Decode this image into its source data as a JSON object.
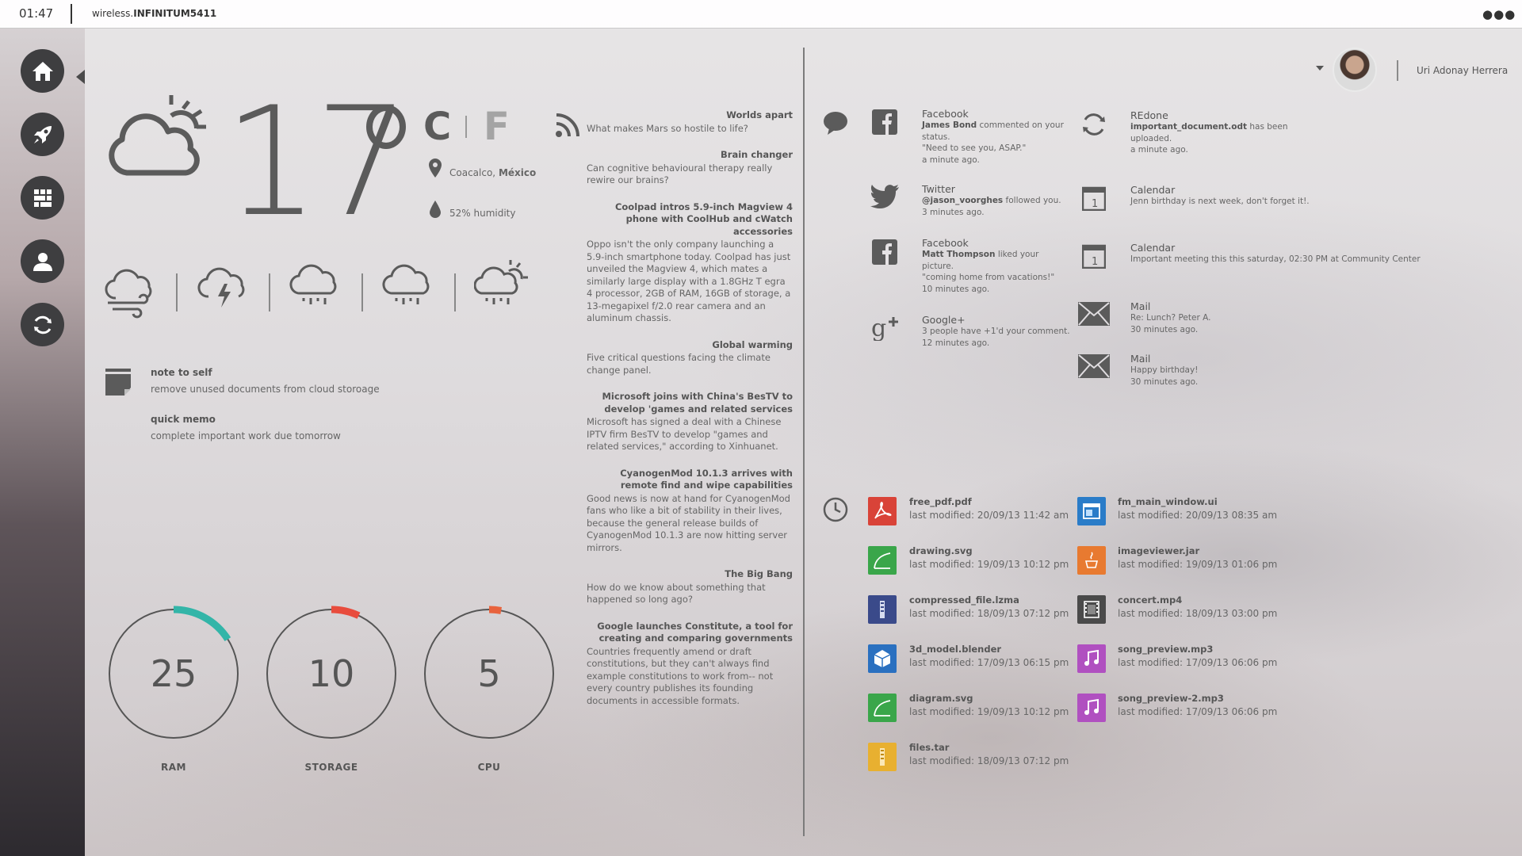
{
  "topbar": {
    "time": "01:47",
    "network_prefix": "wireless.",
    "network_name": "INFINITUM5411",
    "menu_icon": "more-dots-icon"
  },
  "sidebar": {
    "items": [
      {
        "icon": "home-icon"
      },
      {
        "icon": "rocket-icon"
      },
      {
        "icon": "apps-grid-icon"
      },
      {
        "icon": "user-icon"
      },
      {
        "icon": "refresh-icon"
      }
    ]
  },
  "weather": {
    "temperature": "17",
    "unit_c": "C",
    "unit_f": "F",
    "location_city": "Coacalco, ",
    "location_country": "México",
    "humidity": "52% humidity",
    "forecast_icons": [
      "windy-cloud-icon",
      "thunder-cloud-icon",
      "rain-cloud-icon",
      "rain-cloud-icon",
      "sun-rain-cloud-icon"
    ]
  },
  "notes": [
    {
      "title": "note to self",
      "text": "remove unused documents from cloud storoage"
    },
    {
      "title": "quick memo",
      "text": "complete important work due tomorrow"
    }
  ],
  "gauges": [
    {
      "label": "RAM",
      "value": "25",
      "fraction": 0.16,
      "color": "#33b5a8"
    },
    {
      "label": "STORAGE",
      "value": "10",
      "fraction": 0.07,
      "color": "#e84c3d"
    },
    {
      "label": "CPU",
      "value": "5",
      "fraction": 0.03,
      "color": "#e8633d"
    }
  ],
  "news": [
    {
      "title": "Worlds apart",
      "desc": "What makes Mars so hostile to life?"
    },
    {
      "title": "Brain changer",
      "desc": "Can cognitive behavioural therapy really rewire our brains?"
    },
    {
      "title": "Coolpad intros 5.9-inch Magview 4 phone with CoolHub and cWatch accessories",
      "desc": "Oppo isn't the only company launching a 5.9-inch smartphone today. Coolpad has just unveiled the Magview 4, which mates a similarly large display with a 1.8GHz T egra 4 processor, 2GB of RAM, 16GB of storage, a 13-megapixel f/2.0 rear camera and an aluminum chassis."
    },
    {
      "title": "Global warming",
      "desc": "Five critical questions facing the climate change panel."
    },
    {
      "title": "Microsoft joins with China's BesTV to develop 'games and related services",
      "desc": "Microsoft has signed a deal with a Chinese IPTV firm BesTV to develop \"games and related services,\" according to Xinhuanet."
    },
    {
      "title": "CyanogenMod 10.1.3 arrives with remote find and wipe capabilities",
      "desc": "Good news is now at hand for CyanogenMod fans who like a bit of stability in their lives, because the general release builds of CyanogenMod 10.1.3 are now hitting server mirrors."
    },
    {
      "title": "The Big Bang",
      "desc": "How do we know about something that happened so long ago?"
    },
    {
      "title": "Google launches Constitute, a tool for creating and comparing governments",
      "desc": "Countries frequently amend or draft constitutions, but they can't always find example constitutions to work from-- not every country publishes its founding documents in accessible formats."
    }
  ],
  "user": {
    "name": "Uri Adonay Herrera"
  },
  "notifications_left": [
    {
      "app": "Facebook",
      "icon": "facebook-icon",
      "actor": "James Bond",
      "text": " commented on your status.",
      "extra": "\"Need to see you, ASAP.\"",
      "time": "a minute ago."
    },
    {
      "app": "Twitter",
      "icon": "twitter-icon",
      "actor": "@jason_voorghes",
      "text": " followed you.",
      "extra": "",
      "time": "3 minutes ago."
    },
    {
      "app": "Facebook",
      "icon": "facebook-icon",
      "actor": "Matt Thompson",
      "text": " liked your picture.",
      "extra": "\"coming home from vacations!\"",
      "time": "10 minutes ago."
    },
    {
      "app": "Google+",
      "icon": "google-plus-icon",
      "actor": "",
      "text": "3 people have +1'd your comment.",
      "extra": "",
      "time": "12 minutes ago."
    }
  ],
  "notifications_right": [
    {
      "app": "REdone",
      "icon": "sync-icon",
      "actor": "important_document.odt",
      "text": " has been uploaded.",
      "time": "a minute ago."
    },
    {
      "app": "Calendar",
      "icon": "calendar-icon",
      "actor": "",
      "text": "Jenn birthday is next week, don't forget it!.",
      "time": ""
    },
    {
      "app": "Calendar",
      "icon": "calendar-icon",
      "actor": "",
      "text": "Important meeting this this saturday, 02:30 PM at Community Center",
      "time": ""
    },
    {
      "app": "Mail",
      "icon": "mail-icon",
      "actor": "",
      "text": "Re: Lunch? Peter A.",
      "time": "30 minutes ago."
    },
    {
      "app": "Mail",
      "icon": "mail-icon",
      "actor": "",
      "text": "Happy birthday!",
      "time": "30 minutes ago."
    }
  ],
  "files_left": [
    {
      "name": "free_pdf.pdf",
      "modified": "last modified: 20/09/13 11:42 am",
      "icon": "pdf-file-icon",
      "color": "#d94338"
    },
    {
      "name": "drawing.svg",
      "modified": "last modified: 19/09/13 10:12 pm",
      "icon": "svg-file-icon",
      "color": "#3aa64a"
    },
    {
      "name": "compressed_file.lzma",
      "modified": "last modified: 18/09/13 07:12 pm",
      "icon": "archive-file-icon",
      "color": "#3a4a8a"
    },
    {
      "name": "3d_model.blender",
      "modified": "last modified: 17/09/13 06:15 pm",
      "icon": "blender-file-icon",
      "color": "#2a70c0"
    },
    {
      "name": "diagram.svg",
      "modified": "last modified: 19/09/13 10:12 pm",
      "icon": "svg-file-icon",
      "color": "#3aa64a"
    },
    {
      "name": "files.tar",
      "modified": "last modified: 18/09/13 07:12 pm",
      "icon": "tar-file-icon",
      "color": "#e8b030"
    }
  ],
  "files_right": [
    {
      "name": "fm_main_window.ui",
      "modified": "last modified: 20/09/13 08:35 am",
      "icon": "ui-file-icon",
      "color": "#2a7cc8"
    },
    {
      "name": "imageviewer.jar",
      "modified": "last modified: 19/09/13 01:06 pm",
      "icon": "java-file-icon",
      "color": "#e87a30"
    },
    {
      "name": "concert.mp4",
      "modified": "last modified: 18/09/13 03:00 pm",
      "icon": "video-file-icon",
      "color": "#4a4a4a"
    },
    {
      "name": "song_preview.mp3",
      "modified": "last modified: 17/09/13 06:06 pm",
      "icon": "music-file-icon",
      "color": "#b050c0"
    },
    {
      "name": "song_preview-2.mp3",
      "modified": "last modified: 17/09/13 06:06 pm",
      "icon": "music-file-icon",
      "color": "#b050c0"
    }
  ]
}
